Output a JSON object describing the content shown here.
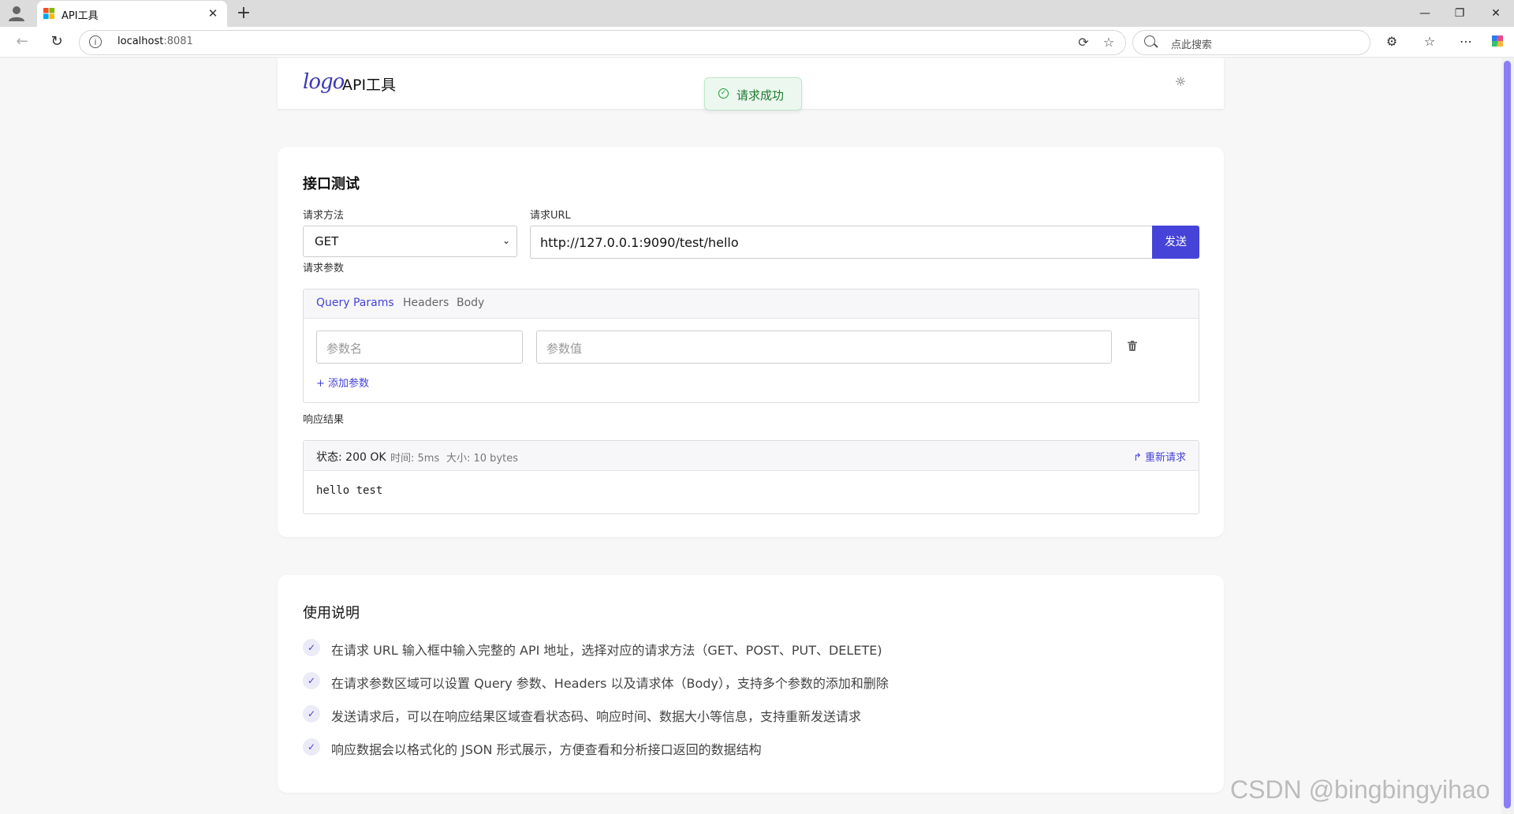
{
  "browser": {
    "tab_title": "API工具",
    "address_host": "localhost",
    "address_port": ":8081",
    "search_placeholder": "点此搜索"
  },
  "app": {
    "logo_text": "logo",
    "title": "API工具"
  },
  "toast": {
    "message": "请求成功"
  },
  "request": {
    "section_title": "接口测试",
    "method_label": "请求方法",
    "method_value": "GET",
    "url_label": "请求URL",
    "url_value": "http://127.0.0.1:9090/test/hello",
    "send_label": "发送",
    "params_label": "请求参数",
    "tabs": [
      "Query Params",
      "Headers",
      "Body"
    ],
    "active_tab": "Query Params",
    "param_name_placeholder": "参数名",
    "param_value_placeholder": "参数值",
    "add_param_label": "+ 添加参数"
  },
  "response": {
    "label": "响应结果",
    "status": "状态: 200 OK",
    "time": "时间: 5ms",
    "size": "大小: 10 bytes",
    "resend_label": "重新请求",
    "body": "hello test"
  },
  "instructions": {
    "title": "使用说明",
    "items": [
      "在请求 URL 输入框中输入完整的 API 地址，选择对应的请求方法（GET、POST、PUT、DELETE)",
      "在请求参数区域可以设置 Query 参数、Headers 以及请求体（Body），支持多个参数的添加和删除",
      "发送请求后，可以在响应结果区域查看状态码、响应时间、数据大小等信息，支持重新发送请求",
      "响应数据会以格式化的 JSON 形式展示，方便查看和分析接口返回的数据结构"
    ]
  },
  "watermark": "CSDN @bingbingyihao",
  "colors": {
    "accent": "#4643d8",
    "success": "#1f9a3a",
    "scrollbar": "#8b7ef5"
  }
}
